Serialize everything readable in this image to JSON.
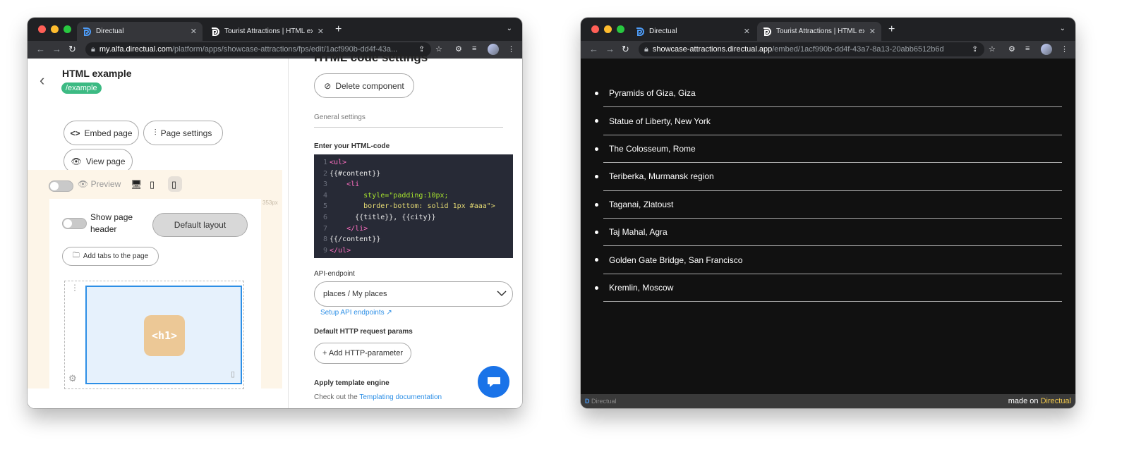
{
  "left_window": {
    "tabs": [
      {
        "title": "Directual",
        "active": true
      },
      {
        "title": "Tourist Attractions | HTML exa",
        "active": false
      }
    ],
    "url_host": "my.alfa.directual.com",
    "url_path": "/platform/apps/showcase-attractions/fps/edit/1acf990b-dd4f-43a...",
    "page": {
      "title": "HTML example",
      "slug": "/example",
      "embed_label": "Embed page",
      "settings_label": "Page settings",
      "view_label": "View page",
      "preview_label": "Preview",
      "width_label": "353px",
      "show_header_label": "Show page header",
      "layout_label": "Default layout",
      "add_tabs_label": "Add tabs to the page",
      "component_label": "<h1>"
    },
    "settings": {
      "heading": "HTML code settings",
      "delete_label": "Delete component",
      "general_label": "General settings",
      "html_label": "Enter your HTML-code",
      "code_lines": [
        "<ul>",
        "{{#content}}",
        "    <li",
        "        style=\"padding:10px;",
        "        border-bottom: solid 1px #aaa\">",
        "      {{title}}, {{city}}",
        "    </li>",
        "{{/content}}",
        "</ul>"
      ],
      "endpoint_label": "API-endpoint",
      "endpoint_value": "places / My places",
      "setup_link": "Setup API endpoints",
      "http_params_label": "Default HTTP request params",
      "add_param_label": "+ Add HTTP-parameter",
      "template_label": "Apply template engine",
      "checkout_text": "Check out the",
      "checkout_link": "Templating documentation"
    }
  },
  "right_window": {
    "tabs": [
      {
        "title": "Directual",
        "active": false
      },
      {
        "title": "Tourist Attractions | HTML exa",
        "active": true
      }
    ],
    "url_host": "showcase-attractions.directual.app",
    "url_path": "/embed/1acf990b-dd4f-43a7-8a13-20abb6512b6d",
    "attractions": [
      "Pyramids of Giza, Giza",
      "Statue of Liberty, New York",
      "The Colosseum, Rome",
      "Teriberka, Murmansk region",
      "Taganai, Zlatoust",
      "Taj Mahal, Agra",
      "Golden Gate Bridge, San Francisco",
      "Kremlin, Moscow"
    ],
    "footer_logo": "Directual",
    "footer_made": "made on",
    "footer_brand": "Directual"
  },
  "colors": {
    "accent_green": "#3cba83",
    "link_blue": "#2d8fe6",
    "brand_yellow": "#f2c94c"
  }
}
